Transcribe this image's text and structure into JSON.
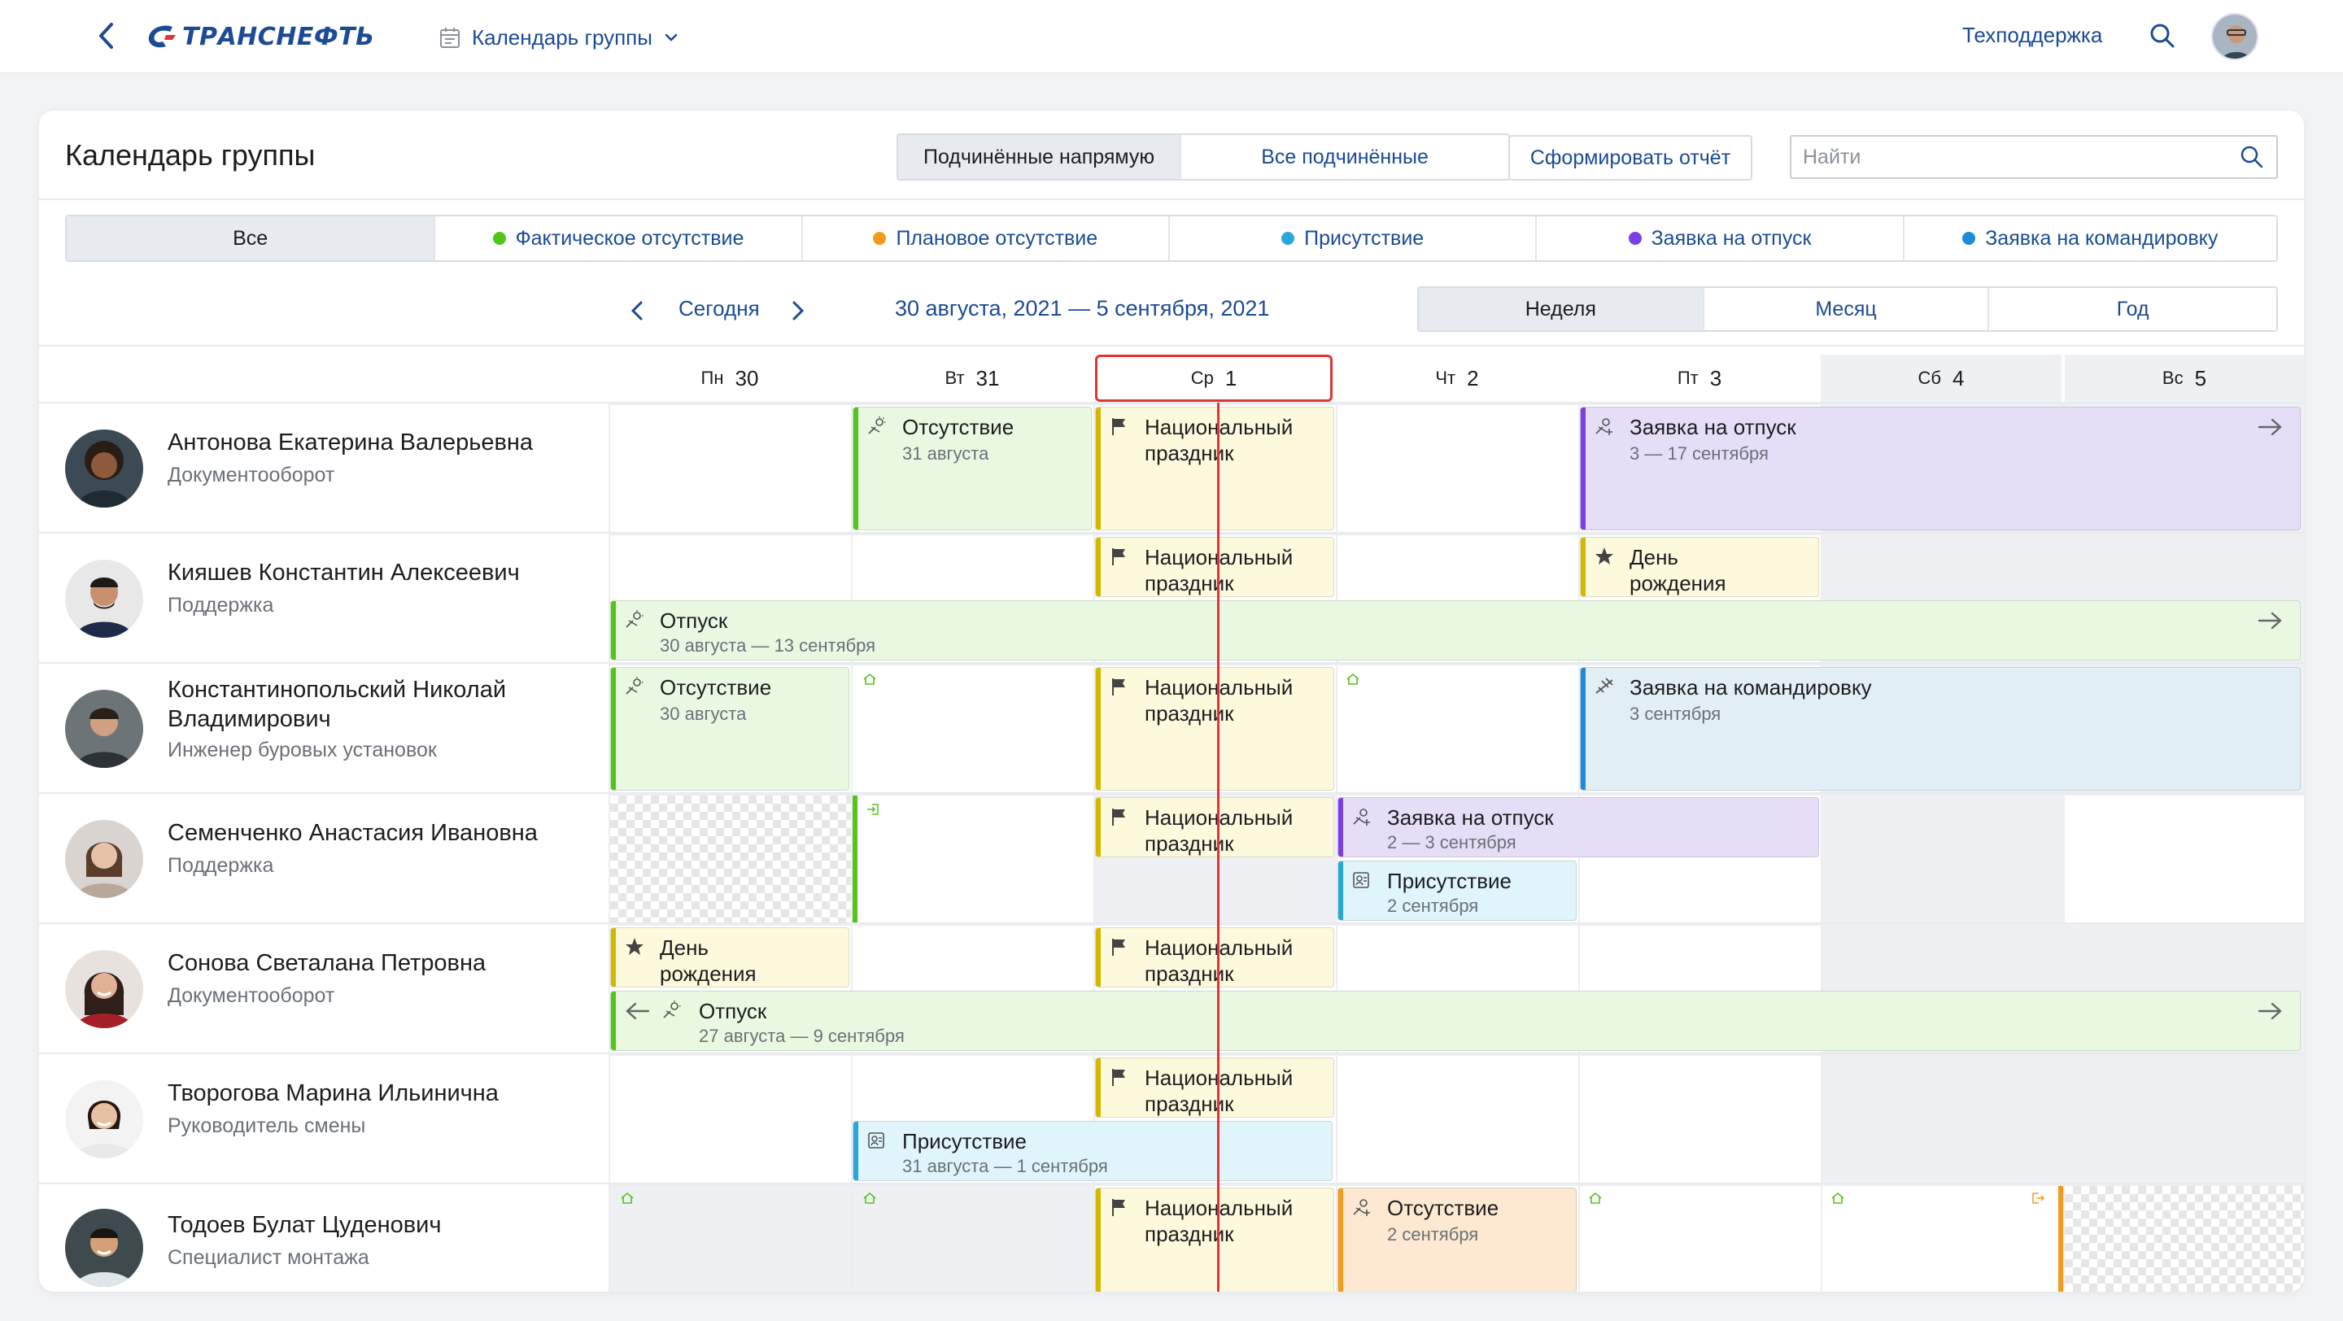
{
  "topbar": {
    "logo_text": "ТРАНСНЕФТЬ",
    "app_title": "Календарь группы",
    "support": "Техподдержка"
  },
  "header": {
    "title": "Календарь группы",
    "scope_options": [
      "Подчинённые напрямую",
      "Все подчинённые"
    ],
    "scope_selected": "Подчинённые напрямую",
    "report_button": "Сформировать отчёт",
    "search_placeholder": "Найти"
  },
  "filters": [
    {
      "label": "Все",
      "color": ""
    },
    {
      "label": "Фактическое отсутствие",
      "color": "#52c41a"
    },
    {
      "label": "Плановое отсутствие",
      "color": "#f39a1e"
    },
    {
      "label": "Присутствие",
      "color": "#29a8d8"
    },
    {
      "label": "Заявка на отпуск",
      "color": "#7b3fe4"
    },
    {
      "label": "Заявка на командировку",
      "color": "#1f8ad9"
    }
  ],
  "navigation": {
    "today": "Сегодня",
    "range": "30 августа, 2021 — 5 сентября, 2021",
    "views": [
      "Неделя",
      "Месяц",
      "Год"
    ],
    "view_selected": "Неделя"
  },
  "days": [
    {
      "dn": "Пн",
      "num": "30"
    },
    {
      "dn": "Вт",
      "num": "31"
    },
    {
      "dn": "Ср",
      "num": "1"
    },
    {
      "dn": "Чт",
      "num": "2"
    },
    {
      "dn": "Пт",
      "num": "3"
    },
    {
      "dn": "Сб",
      "num": "4"
    },
    {
      "dn": "Вс",
      "num": "5"
    }
  ],
  "employees": [
    {
      "name": "Антонова Екатерина Валерьевна",
      "dept": "Документооборот"
    },
    {
      "name": "Кияшев Константин Алексеевич",
      "dept": "Поддержка"
    },
    {
      "name": "Константинопольский Николай Владимирович",
      "dept": "Инженер буровых установок"
    },
    {
      "name": "Семенченко Анастасия Ивановна",
      "dept": "Поддержка"
    },
    {
      "name": "Сонова Светалана Петровна",
      "dept": "Документооборот"
    },
    {
      "name": "Творогова Марина Ильинична",
      "dept": "Руководитель смены"
    },
    {
      "name": "Тодоев Булат Цуденович",
      "dept": "Специалист монтажа"
    }
  ],
  "events": {
    "e1": {
      "title": "Отсутствие",
      "date": "31 августа"
    },
    "holiday": "Национальный праздник",
    "e3": {
      "title": "Заявка на отпуск",
      "date": "3 — 17 сентября"
    },
    "birthday": "День рождения",
    "e5": {
      "title": "Отпуск",
      "date": "30 августа — 13 сентября"
    },
    "e6": {
      "title": "Отсутствие",
      "date": "30 августа"
    },
    "e7": {
      "title": "Заявка на командировку",
      "date": "3 сентября"
    },
    "e8": {
      "title": "Заявка на отпуск",
      "date": "2 — 3 сентября"
    },
    "e9": {
      "title": "Присутствие",
      "date": "2 сентября"
    },
    "e10": {
      "title": "Отпуск",
      "date": "27 августа — 9 сентября"
    },
    "e11": {
      "title": "Присутствие",
      "date": "31 августа — 1 сентября"
    },
    "e12": {
      "title": "Отсутствие",
      "date": "2 сентября"
    }
  }
}
